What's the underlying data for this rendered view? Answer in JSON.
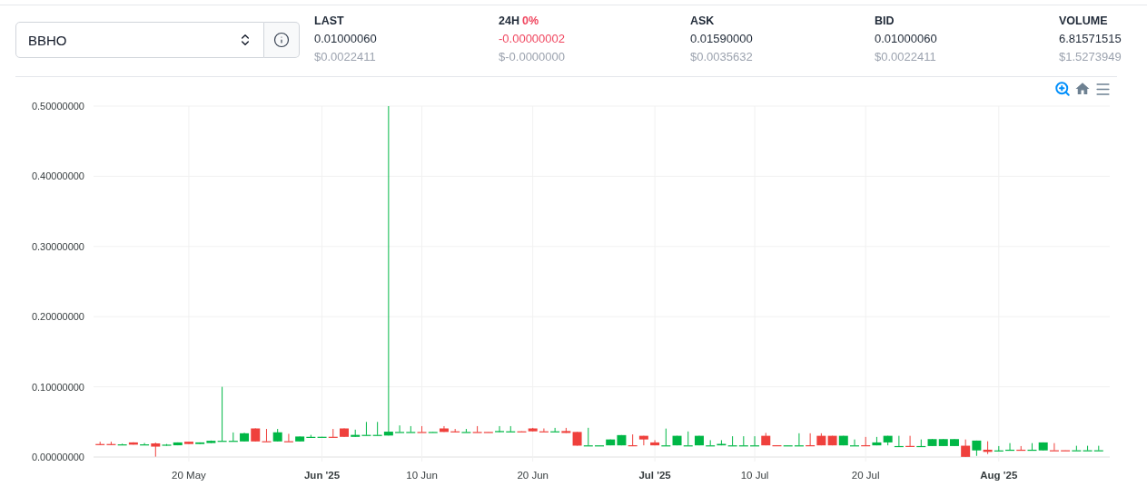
{
  "pair_select": {
    "value": "BBHO"
  },
  "stats": [
    {
      "label": "LAST",
      "value": "0.01000060",
      "usd": "$0.0022411"
    },
    {
      "label": "24H",
      "change": "0%",
      "value": "-0.00000002",
      "usd": "$-0.0000000",
      "color": "#f0465f"
    },
    {
      "label": "ASK",
      "value": "0.01590000",
      "usd": "$0.0035632"
    },
    {
      "label": "BID",
      "value": "0.01000060",
      "usd": "$0.0022411"
    },
    {
      "label": "VOLUME",
      "value": "6.81571515",
      "usd": "$1.5273949"
    }
  ],
  "chart_tools": [
    {
      "kind": "zoom",
      "selected": true
    },
    {
      "kind": "home",
      "selected": false
    },
    {
      "kind": "menu",
      "selected": false
    }
  ],
  "chart": {
    "chart_data": {
      "type": "candlestick",
      "grid": true,
      "xlim": [
        "2025-05-11",
        "2025-08-11"
      ],
      "ylim": [
        0,
        0.5
      ],
      "x": [
        "2025-05-12",
        "2025-05-13",
        "2025-05-14",
        "2025-05-15",
        "2025-05-16",
        "2025-05-17",
        "2025-05-18",
        "2025-05-19",
        "2025-05-20",
        "2025-05-21",
        "2025-05-22",
        "2025-05-23",
        "2025-05-24",
        "2025-05-25",
        "2025-05-26",
        "2025-05-27",
        "2025-05-28",
        "2025-05-29",
        "2025-05-30",
        "2025-05-31",
        "2025-06-01",
        "2025-06-02",
        "2025-06-03",
        "2025-06-04",
        "2025-06-05",
        "2025-06-06",
        "2025-06-07",
        "2025-06-08",
        "2025-06-09",
        "2025-06-10",
        "2025-06-11",
        "2025-06-12",
        "2025-06-13",
        "2025-06-14",
        "2025-06-15",
        "2025-06-16",
        "2025-06-17",
        "2025-06-18",
        "2025-06-19",
        "2025-06-20",
        "2025-06-21",
        "2025-06-22",
        "2025-06-23",
        "2025-06-24",
        "2025-06-25",
        "2025-06-26",
        "2025-06-27",
        "2025-06-28",
        "2025-06-29",
        "2025-06-30",
        "2025-07-01",
        "2025-07-02",
        "2025-07-03",
        "2025-07-04",
        "2025-07-05",
        "2025-07-06",
        "2025-07-07",
        "2025-07-08",
        "2025-07-09",
        "2025-07-10",
        "2025-07-11",
        "2025-07-12",
        "2025-07-13",
        "2025-07-14",
        "2025-07-15",
        "2025-07-16",
        "2025-07-17",
        "2025-07-18",
        "2025-07-19",
        "2025-07-20",
        "2025-07-21",
        "2025-07-22",
        "2025-07-23",
        "2025-07-24",
        "2025-07-25",
        "2025-07-26",
        "2025-07-27",
        "2025-07-28",
        "2025-07-29",
        "2025-07-30",
        "2025-07-31",
        "2025-08-01",
        "2025-08-02",
        "2025-08-03",
        "2025-08-04",
        "2025-08-05",
        "2025-08-06",
        "2025-08-07",
        "2025-08-08",
        "2025-08-09",
        "2025-08-10"
      ],
      "yticks": [
        {
          "value": 0,
          "label": "0.00000000"
        },
        {
          "value": 0.1,
          "label": "0.10000000"
        },
        {
          "value": 0.2,
          "label": "0.20000000"
        },
        {
          "value": 0.3,
          "label": "0.30000000"
        },
        {
          "value": 0.4,
          "label": "0.40000000"
        },
        {
          "value": 0.5,
          "label": "0.50000000"
        }
      ],
      "xticks": [
        {
          "value": "2025-05-20",
          "label": "20 May"
        },
        {
          "value": "2025-06-01",
          "label": "Jun '25"
        },
        {
          "value": "2025-06-10",
          "label": "10 Jun"
        },
        {
          "value": "2025-06-20",
          "label": "20 Jun"
        },
        {
          "value": "2025-07-01",
          "label": "Jul '25"
        },
        {
          "value": "2025-07-10",
          "label": "10 Jul"
        },
        {
          "value": "2025-07-20",
          "label": "20 Jul"
        },
        {
          "value": "2025-08-01",
          "label": "Aug '25"
        }
      ],
      "ohlc": [
        [
          0.0185,
          0.0218,
          0.018,
          0.018
        ],
        [
          0.0185,
          0.0218,
          0.018,
          0.018
        ],
        [
          0.0176,
          0.019,
          0.0176,
          0.018
        ],
        [
          0.0208,
          0.021,
          0.0176,
          0.0176
        ],
        [
          0.0178,
          0.02,
          0.0178,
          0.018
        ],
        [
          0.0194,
          0.0205,
          0.0005,
          0.0148
        ],
        [
          0.0162,
          0.0185,
          0.0162,
          0.0176
        ],
        [
          0.0167,
          0.0208,
          0.0167,
          0.0208
        ],
        [
          0.0218,
          0.0218,
          0.0185,
          0.0185
        ],
        [
          0.0185,
          0.0208,
          0.0185,
          0.0208
        ],
        [
          0.0199,
          0.0235,
          0.0199,
          0.0231
        ],
        [
          0.0222,
          0.1,
          0.0222,
          0.0231
        ],
        [
          0.0222,
          0.035,
          0.0222,
          0.0231
        ],
        [
          0.0222,
          0.0345,
          0.0222,
          0.0338
        ],
        [
          0.0407,
          0.0407,
          0.0222,
          0.0222
        ],
        [
          0.0225,
          0.04,
          0.0222,
          0.0222
        ],
        [
          0.0222,
          0.04,
          0.0222,
          0.0352
        ],
        [
          0.0225,
          0.033,
          0.0222,
          0.0222
        ],
        [
          0.0222,
          0.0292,
          0.0222,
          0.0292
        ],
        [
          0.0283,
          0.0315,
          0.0283,
          0.0287
        ],
        [
          0.0285,
          0.0288,
          0.0285,
          0.0288
        ],
        [
          0.0288,
          0.04,
          0.0285,
          0.0285
        ],
        [
          0.0407,
          0.0407,
          0.0287,
          0.0287
        ],
        [
          0.0287,
          0.039,
          0.0287,
          0.0315
        ],
        [
          0.0313,
          0.05,
          0.0313,
          0.0315
        ],
        [
          0.0313,
          0.05,
          0.0313,
          0.0315
        ],
        [
          0.0306,
          0.5,
          0.0306,
          0.0361
        ],
        [
          0.0354,
          0.045,
          0.0354,
          0.0357
        ],
        [
          0.0354,
          0.044,
          0.0354,
          0.0357
        ],
        [
          0.0357,
          0.044,
          0.0354,
          0.0354
        ],
        [
          0.0354,
          0.036,
          0.0354,
          0.0357
        ],
        [
          0.0407,
          0.044,
          0.0357,
          0.0357
        ],
        [
          0.0366,
          0.04,
          0.0357,
          0.0357
        ],
        [
          0.0354,
          0.04,
          0.0354,
          0.0357
        ],
        [
          0.0357,
          0.044,
          0.0354,
          0.0354
        ],
        [
          0.0357,
          0.0357,
          0.0354,
          0.0354
        ],
        [
          0.0354,
          0.044,
          0.0354,
          0.037
        ],
        [
          0.0363,
          0.044,
          0.0363,
          0.0366
        ],
        [
          0.0366,
          0.0366,
          0.0363,
          0.0363
        ],
        [
          0.0407,
          0.0415,
          0.0366,
          0.0366
        ],
        [
          0.0366,
          0.0407,
          0.0363,
          0.0363
        ],
        [
          0.0363,
          0.0415,
          0.0363,
          0.0366
        ],
        [
          0.037,
          0.0415,
          0.0343,
          0.0343
        ],
        [
          0.0357,
          0.0357,
          0.0162,
          0.0162
        ],
        [
          0.0164,
          0.0416,
          0.0164,
          0.0166
        ],
        [
          0.0164,
          0.0166,
          0.0164,
          0.0166
        ],
        [
          0.0166,
          0.025,
          0.0166,
          0.025
        ],
        [
          0.0166,
          0.0312,
          0.0166,
          0.0312
        ],
        [
          0.0168,
          0.0322,
          0.0166,
          0.0166
        ],
        [
          0.0302,
          0.0302,
          0.0166,
          0.025
        ],
        [
          0.0208,
          0.024,
          0.0166,
          0.0166
        ],
        [
          0.0164,
          0.0405,
          0.0164,
          0.0166
        ],
        [
          0.0166,
          0.0302,
          0.0166,
          0.0302
        ],
        [
          0.0164,
          0.0364,
          0.0164,
          0.0166
        ],
        [
          0.0166,
          0.0302,
          0.0166,
          0.0302
        ],
        [
          0.0164,
          0.024,
          0.0164,
          0.0166
        ],
        [
          0.0166,
          0.024,
          0.0166,
          0.0187
        ],
        [
          0.0164,
          0.0296,
          0.0164,
          0.0166
        ],
        [
          0.0164,
          0.0296,
          0.0164,
          0.0166
        ],
        [
          0.0164,
          0.0296,
          0.0164,
          0.0166
        ],
        [
          0.0302,
          0.0343,
          0.0166,
          0.0166
        ],
        [
          0.0168,
          0.0168,
          0.0166,
          0.0166
        ],
        [
          0.0164,
          0.0166,
          0.0164,
          0.0166
        ],
        [
          0.0164,
          0.0338,
          0.0164,
          0.0166
        ],
        [
          0.0168,
          0.0338,
          0.0166,
          0.0166
        ],
        [
          0.0302,
          0.0338,
          0.0166,
          0.0166
        ],
        [
          0.0302,
          0.0302,
          0.0166,
          0.0166
        ],
        [
          0.0166,
          0.0302,
          0.0166,
          0.0302
        ],
        [
          0.0164,
          0.025,
          0.0164,
          0.0166
        ],
        [
          0.0168,
          0.0286,
          0.0166,
          0.0166
        ],
        [
          0.0166,
          0.0286,
          0.0166,
          0.0208
        ],
        [
          0.0208,
          0.0302,
          0.0166,
          0.0302
        ],
        [
          0.0154,
          0.0302,
          0.0154,
          0.0156
        ],
        [
          0.0158,
          0.0302,
          0.0156,
          0.0156
        ],
        [
          0.0154,
          0.025,
          0.0154,
          0.0156
        ],
        [
          0.0156,
          0.0255,
          0.0156,
          0.0255
        ],
        [
          0.0156,
          0.0255,
          0.0156,
          0.0255
        ],
        [
          0.0156,
          0.0255,
          0.0156,
          0.0255
        ],
        [
          0.0161,
          0.025,
          0.0002,
          0.0002
        ],
        [
          0.0094,
          0.0234,
          0.0016,
          0.0234
        ],
        [
          0.0104,
          0.0224,
          0.0042,
          0.0073
        ],
        [
          0.0083,
          0.0156,
          0.0083,
          0.0094
        ],
        [
          0.0094,
          0.0198,
          0.0094,
          0.0104
        ],
        [
          0.0104,
          0.0156,
          0.0094,
          0.0094
        ],
        [
          0.0102,
          0.0198,
          0.0102,
          0.0104
        ],
        [
          0.0094,
          0.0208,
          0.0094,
          0.0208
        ],
        [
          0.0096,
          0.0198,
          0.0094,
          0.0094
        ],
        [
          0.0096,
          0.0096,
          0.0094,
          0.0094
        ],
        [
          0.0094,
          0.016,
          0.0094,
          0.0096
        ],
        [
          0.0094,
          0.016,
          0.0094,
          0.0096
        ],
        [
          0.0094,
          0.016,
          0.0094,
          0.0096
        ]
      ]
    }
  }
}
